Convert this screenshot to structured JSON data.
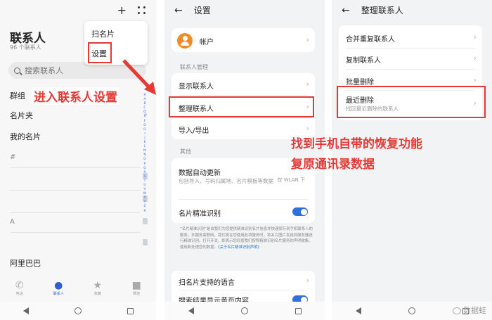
{
  "panel1": {
    "title": "联系人",
    "subtitle": "96 个联系人",
    "search_placeholder": "搜索联系人",
    "rows": {
      "groups": "群组",
      "card_holder": "名片夹",
      "my_card": "我的名片"
    },
    "section_hash": "#",
    "section_a": "A",
    "contact": "阿里巴巴",
    "alphabet": [
      "#",
      "A",
      "B",
      "C",
      "D",
      "E",
      "F",
      "G",
      "H",
      "I",
      "J",
      "K",
      "L",
      "M",
      "N",
      "O",
      "P",
      "Q",
      "R",
      "S",
      "T",
      "U",
      "V",
      "W",
      "X",
      "Y",
      "Z",
      "#"
    ],
    "popup": {
      "scan": "扫名片",
      "settings": "设置"
    },
    "tabs": [
      {
        "label": "电话",
        "icon": "phone-icon"
      },
      {
        "label": "联系人",
        "icon": "person-icon"
      },
      {
        "label": "收藏",
        "icon": "star-icon"
      },
      {
        "label": "畅连",
        "icon": "video-icon"
      }
    ]
  },
  "panel2": {
    "title": "设置",
    "account": "帐户",
    "section_manage": "联系人管理",
    "display": "显示联系人",
    "organize": "整理联系人",
    "import_export": "导入/导出",
    "section_other": "其他",
    "auto_update": "数据自动更新",
    "auto_update_desc": "包括导入、号码归属地、名片模板等数据",
    "wlan_hint": "仅 WLAN 下",
    "card_precise": "名片精准识别",
    "note": "“名片精准识别”是由我们为您提供精准识别名片信息并快速保存到手机联系人的服务。本服务需联网，我们将在您使用此项服务时，将名片图片发送到服务器进行精准识别。打开开关，即表示您同意我们按照精准识别名片服务的声明收集、使用和处理您的数据。",
    "note_link": "《关于名片精准识别声明》",
    "languages": "扫名片支持的语言",
    "search_yellow": "搜索结果显示黄页内容"
  },
  "panel3": {
    "title": "整理联系人",
    "merge": "合并重复联系人",
    "copy": "复制联系人",
    "batch_delete": "批量删除",
    "recent_delete": "最近删除",
    "recent_desc": "找回最近删除的联系人"
  },
  "annotations": {
    "enter_settings": "进入联系人设置",
    "find_restore_1": "找到手机自带的恢复功能",
    "find_restore_2": "复原通讯录数据"
  },
  "watermark": "数据蛙",
  "colors": {
    "accent_blue": "#2f6fe0",
    "highlight_red": "#e53935",
    "avatar_orange": "#f28a25"
  }
}
